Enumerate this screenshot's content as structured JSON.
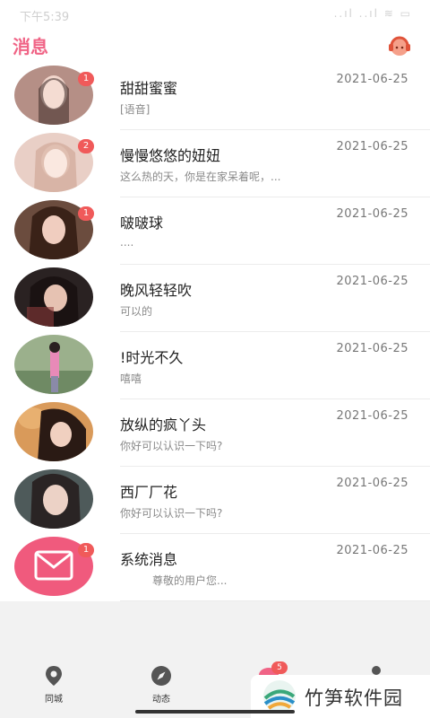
{
  "status_bar": {
    "time": "下午5:39",
    "icons": "..ıl ..ıl ≋ ▭"
  },
  "header": {
    "title": "消息",
    "service_icon": "customer-service-icon"
  },
  "messages": [
    {
      "name": "甜甜蜜蜜",
      "date": "2021-06-25",
      "preview": "[语音]",
      "badge": "1",
      "avatar_color": "#c9a9a0"
    },
    {
      "name": "慢慢悠悠的妞妞",
      "date": "2021-06-25",
      "preview": "这么热的天，你是在家呆着呢，...",
      "badge": "2",
      "avatar_color": "#e8c3b8"
    },
    {
      "name": "啵啵球",
      "date": "2021-06-25",
      "preview": "....",
      "badge": "1",
      "avatar_color": "#7a5a4a"
    },
    {
      "name": "晚风轻轻吹",
      "date": "2021-06-25",
      "preview": "可以的",
      "badge": "",
      "avatar_color": "#3a3030"
    },
    {
      "name": "!时光不久",
      "date": "2021-06-25",
      "preview": "嘻嘻",
      "badge": "",
      "avatar_color": "#8aa07a"
    },
    {
      "name": "放纵的疯丫头",
      "date": "2021-06-25",
      "preview": "你好可以认识一下吗?",
      "badge": "",
      "avatar_color": "#d99a5a"
    },
    {
      "name": "西厂厂花",
      "date": "2021-06-25",
      "preview": "你好可以认识一下吗?",
      "badge": "",
      "avatar_color": "#5a6a6a"
    },
    {
      "name": "系统消息",
      "date": "2021-06-25",
      "preview": "尊敬的用户您...",
      "badge": "1",
      "avatar_color": "#f05a7d"
    }
  ],
  "tabs": [
    {
      "label": "同城",
      "icon": "location-pin-icon"
    },
    {
      "label": "动态",
      "icon": "compass-icon"
    },
    {
      "label": "",
      "icon": "message-icon",
      "badge": "5"
    },
    {
      "label": "",
      "icon": "person-icon"
    }
  ],
  "watermark": {
    "text": "竹笋软件园"
  },
  "colors": {
    "accent": "#f06486",
    "badge": "#f05a5a",
    "system_avatar": "#f05a7d"
  }
}
